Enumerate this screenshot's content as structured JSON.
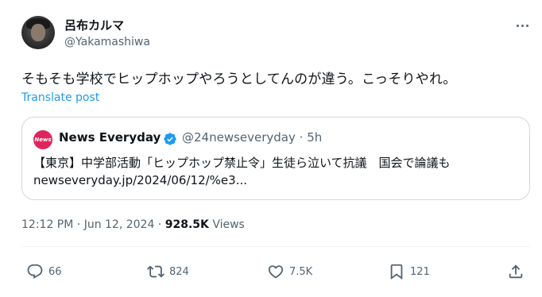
{
  "author": {
    "name": "呂布カルマ",
    "handle": "@Yakamashiwa"
  },
  "tweet": {
    "text": "そもそも学校でヒップホップやろうとしてんのが違う。こっそりやれ。",
    "translate_label": "Translate post"
  },
  "quote": {
    "logo_text": "News",
    "name": "News Everyday",
    "handle": "@24newseveryday",
    "time": "5h",
    "line1": "【東京】中学部活動「ヒップホップ禁止令」生徒ら泣いて抗議　国会で論議も",
    "line2": "newseveryday.jp/2024/06/12/%e3..."
  },
  "meta": {
    "time": "12:12 PM",
    "date": "Jun 12, 2024",
    "views_count": "928.5K",
    "views_label": "Views"
  },
  "actions": {
    "replies": "66",
    "reposts": "824",
    "likes": "7.5K",
    "bookmarks": "121"
  },
  "colors": {
    "text": "#0f1419",
    "secondary": "#536471",
    "link": "#1d9bf0",
    "border": "#cfd9de",
    "verified": "#1d9bf0",
    "news_logo": "#e0245e"
  }
}
